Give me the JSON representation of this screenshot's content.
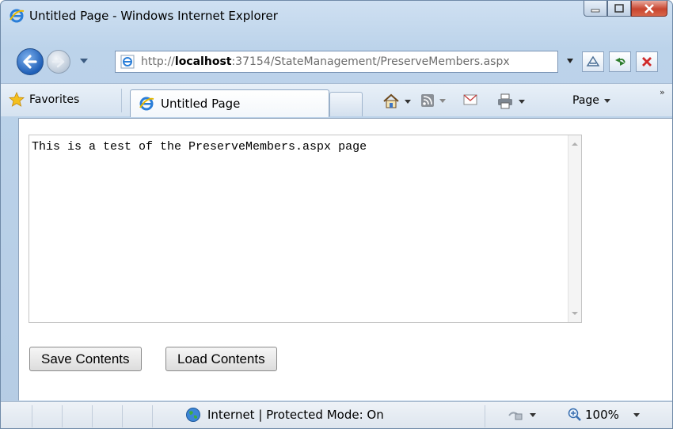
{
  "window": {
    "title": "Untitled Page - Windows Internet Explorer"
  },
  "address_bar": {
    "prefix": "http://",
    "host": "localhost",
    "rest": ":37154/StateManagement/PreserveMembers.aspx"
  },
  "favorites_bar": {
    "favorites_label": "Favorites",
    "tab_title": "Untitled Page",
    "page_menu_label": "Page",
    "overflow_glyph": "»"
  },
  "page": {
    "textarea_value": "This is a test of the PreserveMembers.aspx page",
    "buttons": {
      "save": "Save Contents",
      "load": "Load Contents"
    }
  },
  "status_bar": {
    "zone_text": "Internet | Protected Mode: On",
    "zoom_text": "100%"
  },
  "icons": {
    "ie_logo": "ie-logo-icon",
    "back": "back-arrow-icon",
    "forward": "forward-arrow-icon",
    "home": "home-icon",
    "feeds": "feeds-icon",
    "mail": "mail-icon",
    "print": "print-icon",
    "favorites_star": "star-icon",
    "compat": "compatibility-view-icon",
    "refresh": "refresh-icon",
    "stop": "stop-icon",
    "globe": "globe-icon",
    "zoom": "zoom-icon"
  },
  "colors": {
    "chrome": "#bcd3ea",
    "close_button": "#c8452f",
    "back_button": "#1f5fb7"
  }
}
